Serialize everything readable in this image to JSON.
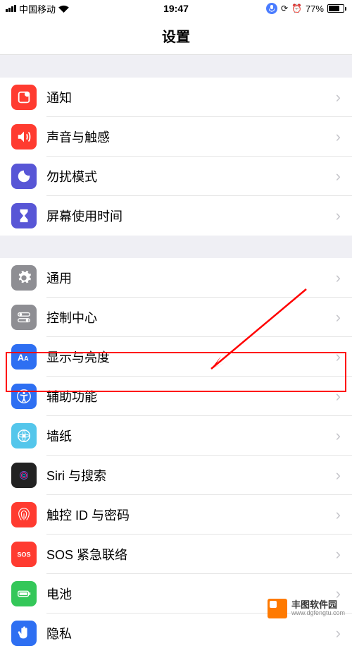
{
  "status": {
    "carrier": "中国移动",
    "time": "19:47",
    "battery_percent": "77%"
  },
  "header": {
    "title": "设置"
  },
  "groups": [
    {
      "items": [
        {
          "id": "notifications",
          "label": "通知",
          "icon": "notifications-icon",
          "color": "#ff3b30"
        },
        {
          "id": "sound",
          "label": "声音与触感",
          "icon": "sound-icon",
          "color": "#ff3b30"
        },
        {
          "id": "dnd",
          "label": "勿扰模式",
          "icon": "moon-icon",
          "color": "#5856d6"
        },
        {
          "id": "screentime",
          "label": "屏幕使用时间",
          "icon": "hourglass-icon",
          "color": "#5856d6"
        }
      ]
    },
    {
      "items": [
        {
          "id": "general",
          "label": "通用",
          "icon": "gear-icon",
          "color": "#8e8e93"
        },
        {
          "id": "control",
          "label": "控制中心",
          "icon": "switches-icon",
          "color": "#8e8e93"
        },
        {
          "id": "display",
          "label": "显示与亮度",
          "icon": "text-size-icon",
          "color": "#2e6ff2"
        },
        {
          "id": "accessibility",
          "label": "辅助功能",
          "icon": "accessibility-icon",
          "color": "#2e6ff2"
        },
        {
          "id": "wallpaper",
          "label": "墙纸",
          "icon": "wallpaper-icon",
          "color": "#54c6eb"
        },
        {
          "id": "siri",
          "label": "Siri 与搜索",
          "icon": "siri-icon",
          "color": "#222"
        },
        {
          "id": "touchid",
          "label": "触控 ID 与密码",
          "icon": "fingerprint-icon",
          "color": "#ff3b30"
        },
        {
          "id": "sos",
          "label": "SOS 紧急联络",
          "icon": "sos-icon",
          "color": "#ff3b30"
        },
        {
          "id": "battery",
          "label": "电池",
          "icon": "battery-icon",
          "color": "#34c759"
        },
        {
          "id": "privacy",
          "label": "隐私",
          "icon": "hand-icon",
          "color": "#2e6ff2"
        }
      ]
    }
  ],
  "annotation": {
    "highlight_target": "accessibility"
  },
  "watermark": {
    "name": "丰图软件园",
    "url": "www.dgfengtu.com"
  }
}
